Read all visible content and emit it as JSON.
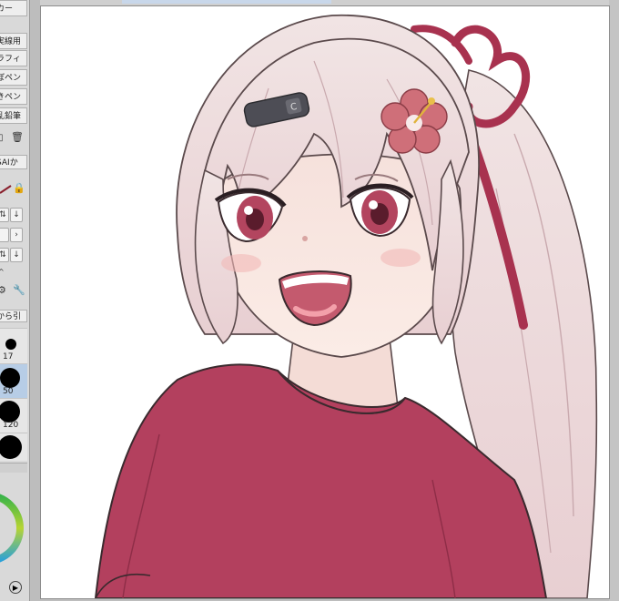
{
  "tool_panel": {
    "items": [
      {
        "label": "カー"
      },
      {
        "label": "実線用"
      },
      {
        "label": "ラフィ"
      },
      {
        "label": "ぼペン"
      },
      {
        "label": "きペン"
      },
      {
        "label": "乱鉛筆"
      }
    ],
    "brush_preset_label": "SAIか",
    "pick_label": "から引",
    "brush_sizes": [
      {
        "value": "17"
      },
      {
        "value": "50"
      },
      {
        "value": "120"
      }
    ],
    "selected_size": "50"
  },
  "canvas": {
    "background": "#ffffff",
    "colors": {
      "hair": "#f3e6e6",
      "shirt": "#b3405e",
      "ribbon": "#a8324f",
      "skin": "#fbece6",
      "eyes": "#b3455f",
      "flower": "#cf6f79",
      "clip": "#4d4d55"
    }
  }
}
